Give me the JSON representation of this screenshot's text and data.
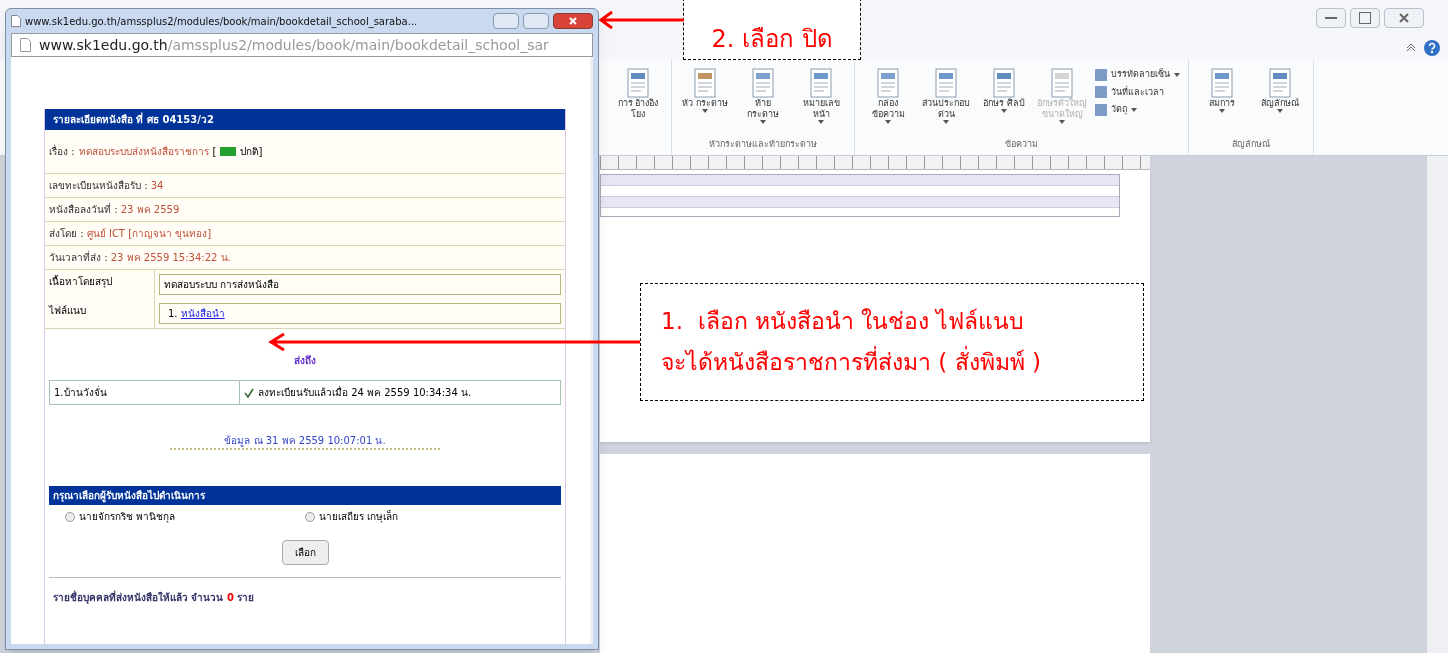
{
  "word": {
    "ribbon": {
      "groups": [
        {
          "buttons": [
            {
              "label": "การ อ้างอิงโยง",
              "kind": "large",
              "dropdown": false
            }
          ]
        },
        {
          "label": "หัวกระดาษและท้ายกระดาษ",
          "buttons": [
            {
              "label": "หัว กระดาษ",
              "kind": "large",
              "dropdown": true
            },
            {
              "label": "ท้าย กระดาษ",
              "kind": "large",
              "dropdown": true
            },
            {
              "label": "หมายเลข หน้า",
              "kind": "large",
              "dropdown": true
            }
          ]
        },
        {
          "label": "ข้อความ",
          "buttons": [
            {
              "label": "กล่อง ข้อความ",
              "kind": "large",
              "dropdown": true
            },
            {
              "label": "ส่วนประกอบ ด่วน",
              "kind": "large",
              "dropdown": true
            },
            {
              "label": "อักษร ศิลป์",
              "kind": "large",
              "dropdown": true
            },
            {
              "label": "อักษรตัวใหญ่ ขนาดใหญ่",
              "kind": "large",
              "dropdown": true,
              "disabled": true
            },
            {
              "label": "บรรทัดลายเซ็น",
              "kind": "small",
              "dropdown": true
            },
            {
              "label": "วันที่และเวลา",
              "kind": "small",
              "dropdown": false
            },
            {
              "label": "วัตถุ",
              "kind": "small",
              "dropdown": true
            }
          ]
        },
        {
          "label": "สัญลักษณ์",
          "buttons": [
            {
              "label": "สมการ",
              "kind": "large",
              "dropdown": true
            },
            {
              "label": "สัญลักษณ์",
              "kind": "large",
              "dropdown": true
            }
          ]
        }
      ]
    }
  },
  "popup": {
    "title": "www.sk1edu.go.th/amssplus2/modules/book/main/bookdetail_school_saraba...",
    "address_host": "www.sk1edu.go.th",
    "address_path": "/amssplus2/modules/book/main/bookdetail_school_sar",
    "header": "รายละเอียดหนังสือ ที่ ศธ 04153/ว2",
    "subject": {
      "label": "เรื่อง :",
      "value": "ทดสอบระบบส่งหนังสือราชการ",
      "bracket": "[",
      "priority": "ปกติ]"
    },
    "fields": [
      {
        "label": "เลขทะเบียนหนังสือรับ :",
        "value": "34"
      },
      {
        "label": "หนังสือลงวันที่ :",
        "value": "23 พค 2559"
      },
      {
        "label": "ส่งโดย :",
        "value": "ศูนย์ ICT [กาญจนา ขุนทอง]"
      },
      {
        "label": "วันเวลาที่ส่ง :",
        "value": "23 พค 2559 15:34:22 น."
      }
    ],
    "summary": {
      "label": "เนื้อหาโดยสรุป",
      "value": "ทดสอบระบบ การส่งหนังสือ"
    },
    "attachment": {
      "label": "ไฟล์แนบ",
      "number": "1.",
      "link": "หนังสือนำ"
    },
    "sent_to": {
      "title": "ส่งถึง",
      "rows": [
        {
          "school": "1.บ้านวังจั่น",
          "status": "ลงทะเบียนรับแล้วเมื่อ 24 พค 2559 10:34:34 น.",
          "received": true
        }
      ]
    },
    "data_as_of": "ข้อมูล ณ 31 พค 2559 10:07:01 น.",
    "forward": {
      "header": "กรุณาเลือกผู้รับหนังสือไปดำเนินการ",
      "options": [
        {
          "label": "นายจักรกริช พานิชกุล",
          "selected": false
        },
        {
          "label": "นายเสถียร เกษุเล็ก",
          "selected": false
        }
      ],
      "button": "เลือก"
    },
    "footer": {
      "before": "รายชื่อบุคคลที่ส่งหนังสือให้แล้ว จำนวน",
      "count": "0",
      "after": "ราย"
    }
  },
  "annotations": [
    {
      "text": "2. เลือก ปิด"
    },
    {
      "lines": [
        "1.  เลือก หนังสือนำ ในช่อง ไฟล์แนบ",
        "จะได้หนังสือราชการที่ส่งมา ( สั่งพิมพ์ )"
      ]
    }
  ]
}
